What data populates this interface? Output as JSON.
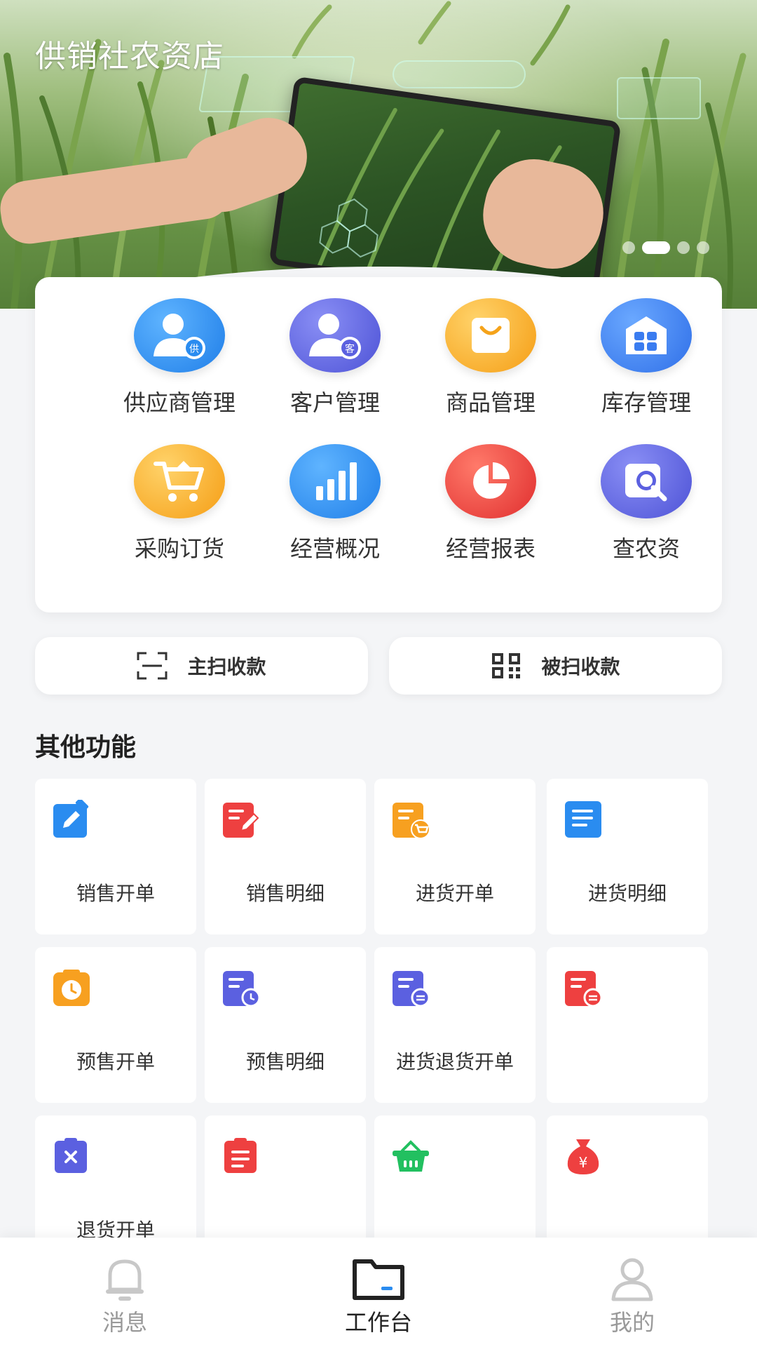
{
  "banner": {
    "title": "供销社农资店",
    "slide_count": 4,
    "active_slide": 2
  },
  "menu": {
    "items": [
      {
        "label": "供应商管理",
        "icon": "supplier-icon",
        "badge": "供",
        "color": "#2a8cf0"
      },
      {
        "label": "客户管理",
        "icon": "customer-icon",
        "badge": "客",
        "color": "#5b60e0"
      },
      {
        "label": "商品管理",
        "icon": "shopping-bag-icon",
        "color": "#f7a824"
      },
      {
        "label": "库存管理",
        "icon": "warehouse-icon",
        "color": "#3a7cf0"
      },
      {
        "label": "采购订货",
        "icon": "cart-icon",
        "color": "#f7a824"
      },
      {
        "label": "经营概况",
        "icon": "bar-chart-icon",
        "color": "#2a8cf0"
      },
      {
        "label": "经营报表",
        "icon": "pie-chart-icon",
        "color": "#ee3b3b"
      },
      {
        "label": "查农资",
        "icon": "search-doc-icon",
        "color": "#5b60e0"
      }
    ]
  },
  "scan": {
    "active_label": "主扫收款",
    "passive_label": "被扫收款"
  },
  "other": {
    "title": "其他功能",
    "tiles": [
      {
        "label": "销售开单",
        "icon": "edit-icon",
        "color": "#2a8cf0"
      },
      {
        "label": "销售明细",
        "icon": "doc-edit-icon",
        "color": "#ee4040"
      },
      {
        "label": "进货开单",
        "icon": "doc-cart-icon",
        "color": "#f7a020"
      },
      {
        "label": "进货明细",
        "icon": "doc-list-icon",
        "color": "#2a8cf0"
      },
      {
        "label": "预售开单",
        "icon": "clock-icon",
        "color": "#f7a020"
      },
      {
        "label": "预售明细",
        "icon": "doc-clock-icon",
        "color": "#5b60e0"
      },
      {
        "label": "进货退货开单",
        "icon": "doc-return-icon",
        "color": "#5b60e0"
      },
      {
        "label": "",
        "icon": "doc-return-red-icon",
        "color": "#ee4040"
      },
      {
        "label": "退货开单",
        "icon": "clipboard-x-icon",
        "color": "#5b60e0"
      },
      {
        "label": "",
        "icon": "doc-red-icon",
        "color": "#ee4040"
      },
      {
        "label": "",
        "icon": "basket-icon",
        "color": "#22c060"
      },
      {
        "label": "",
        "icon": "money-bag-icon",
        "color": "#ee4040"
      }
    ]
  },
  "nav": {
    "items": [
      {
        "label": "消息",
        "icon": "bell-icon",
        "active": false
      },
      {
        "label": "工作台",
        "icon": "folder-icon",
        "active": true
      },
      {
        "label": "我的",
        "icon": "user-icon",
        "active": false
      }
    ]
  }
}
